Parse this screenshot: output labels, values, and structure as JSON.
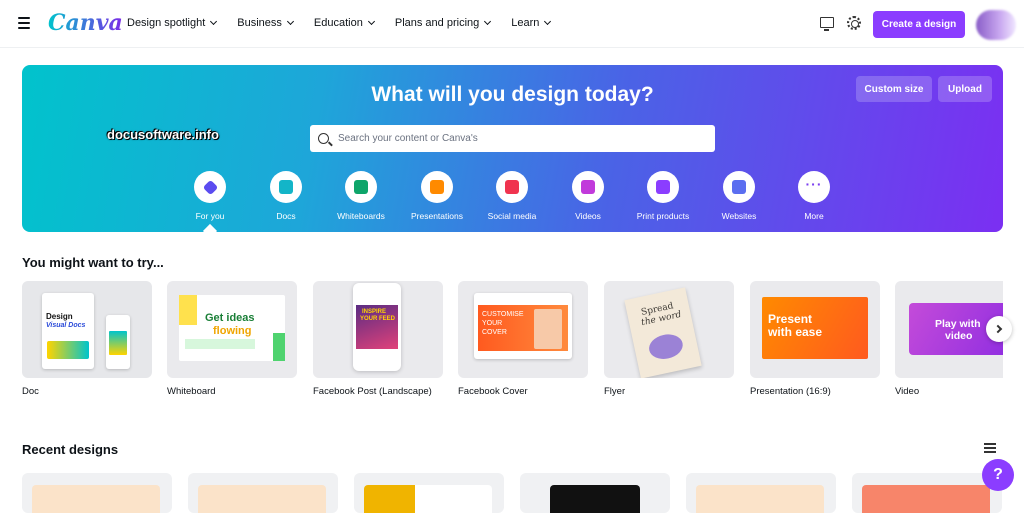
{
  "nav": {
    "logo": "Canva",
    "menu": [
      {
        "label": "Design spotlight"
      },
      {
        "label": "Business"
      },
      {
        "label": "Education"
      },
      {
        "label": "Plans and pricing"
      },
      {
        "label": "Learn"
      }
    ],
    "create_button": "Create a design",
    "icons": [
      "menu-icon",
      "monitor-icon",
      "gear-icon"
    ]
  },
  "hero": {
    "title": "What will you design today?",
    "watermark": "docusoftware.info",
    "search_placeholder": "Search your content or Canva's",
    "custom_size": "Custom size",
    "upload": "Upload",
    "gradient": [
      "#01c3cc",
      "#7b2ff2"
    ],
    "categories": [
      {
        "label": "For you",
        "icon": "sparkle-icon",
        "color": "#5b4cf0"
      },
      {
        "label": "Docs",
        "icon": "docs-icon",
        "color": "#13b5c8"
      },
      {
        "label": "Whiteboards",
        "icon": "whiteboard-icon",
        "color": "#0ea56a"
      },
      {
        "label": "Presentations",
        "icon": "presentation-icon",
        "color": "#ff8a00"
      },
      {
        "label": "Social media",
        "icon": "heart-icon",
        "color": "#f0334f"
      },
      {
        "label": "Videos",
        "icon": "video-icon",
        "color": "#c13adb"
      },
      {
        "label": "Print products",
        "icon": "print-icon",
        "color": "#8b3dff"
      },
      {
        "label": "Websites",
        "icon": "website-icon",
        "color": "#5b6ef0"
      },
      {
        "label": "More",
        "icon": "more-icon",
        "color": "#7b3ff0"
      }
    ]
  },
  "suggestions": {
    "title": "You might want to try...",
    "items": [
      {
        "label": "Doc",
        "art": [
          "Design",
          "Visual Docs"
        ]
      },
      {
        "label": "Whiteboard",
        "art": [
          "Get ideas",
          "flowing"
        ]
      },
      {
        "label": "Facebook Post (Landscape)",
        "art": [
          "INSPIRE",
          "YOUR FEED"
        ]
      },
      {
        "label": "Facebook Cover",
        "art": [
          "CUSTOMISE",
          "YOUR",
          "COVER"
        ]
      },
      {
        "label": "Flyer",
        "art": [
          "Spread",
          "the word"
        ]
      },
      {
        "label": "Presentation (16:9)",
        "art": [
          "Present",
          "with ease"
        ]
      },
      {
        "label": "Video",
        "art": [
          "Play with",
          "video"
        ]
      }
    ]
  },
  "recent": {
    "title": "Recent designs"
  },
  "help_label": "?",
  "accent": "#8b3dff"
}
